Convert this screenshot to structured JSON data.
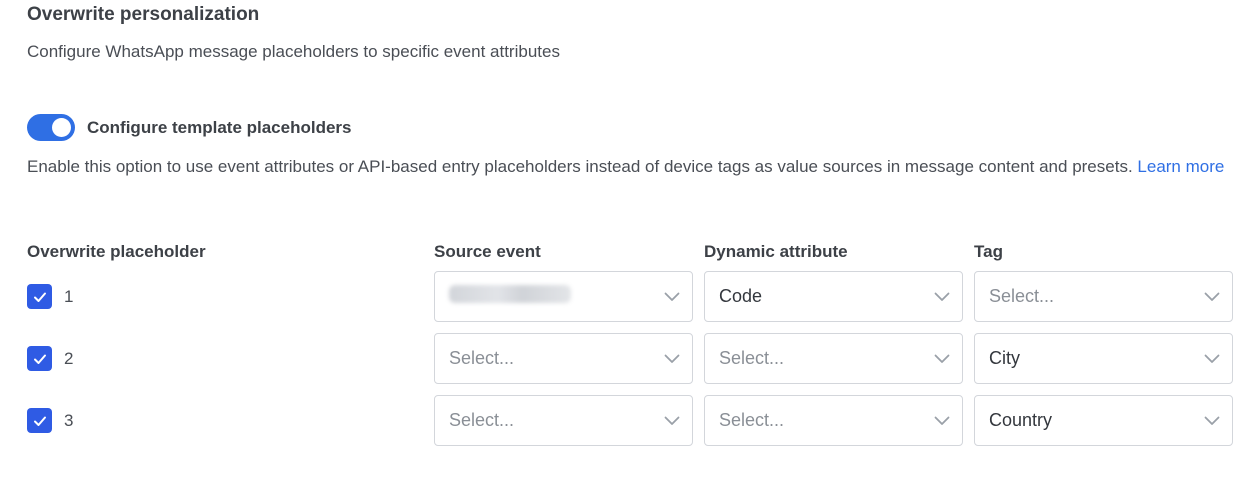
{
  "section": {
    "title": "Overwrite personalization",
    "subtitle": "Configure WhatsApp message placeholders to specific event attributes"
  },
  "toggle": {
    "label": "Configure template placeholders",
    "enabled": true,
    "accent_color": "#2f6fe4"
  },
  "description": {
    "text": "Enable this option to use event attributes or API-based entry placeholders instead of device tags as value sources in message content and presets.",
    "link_label": "Learn more"
  },
  "columns": {
    "placeholder": "Overwrite placeholder",
    "source_event": "Source event",
    "dynamic_attribute": "Dynamic attribute",
    "tag": "Tag"
  },
  "rows": [
    {
      "number": "1",
      "checked": true,
      "source_event": "",
      "dynamic_attribute": "Code",
      "tag": "Select..."
    },
    {
      "number": "2",
      "checked": true,
      "source_event": "Select...",
      "dynamic_attribute": "Select...",
      "tag": "City"
    },
    {
      "number": "3",
      "checked": true,
      "source_event": "Select...",
      "dynamic_attribute": "Select...",
      "tag": "Country"
    }
  ]
}
